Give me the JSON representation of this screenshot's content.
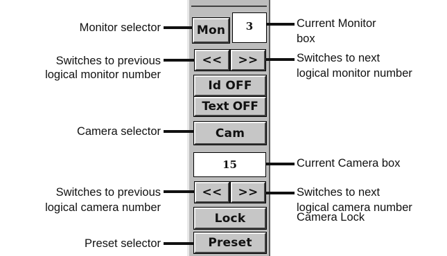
{
  "panel": {
    "monitor_button": "Mon",
    "current_monitor": "3",
    "prev_monitor": "<<",
    "next_monitor": ">>",
    "id_button": "Id OFF",
    "text_button": "Text OFF",
    "camera_button": "Cam",
    "current_camera": "15",
    "prev_camera": "<<",
    "next_camera": ">>",
    "lock_button": "Lock",
    "preset_button": "Preset"
  },
  "callouts": {
    "monitor_selector": "Monitor selector",
    "current_monitor_line1": "Current Monitor",
    "current_monitor_line2": "box",
    "prev_monitor_line1": "Switches to previous",
    "prev_monitor_line2": "logical monitor number",
    "next_monitor_line1": "Switches to next",
    "next_monitor_line2": "logical monitor number",
    "camera_selector": "Camera selector",
    "current_camera": "Current Camera box",
    "prev_camera_line1": "Switches to previous",
    "prev_camera_line2": "logical camera number",
    "next_camera_line1": "Switches to next",
    "next_camera_line2": "logical camera number",
    "camera_lock": "Camera Lock",
    "preset_selector": "Preset selector"
  }
}
